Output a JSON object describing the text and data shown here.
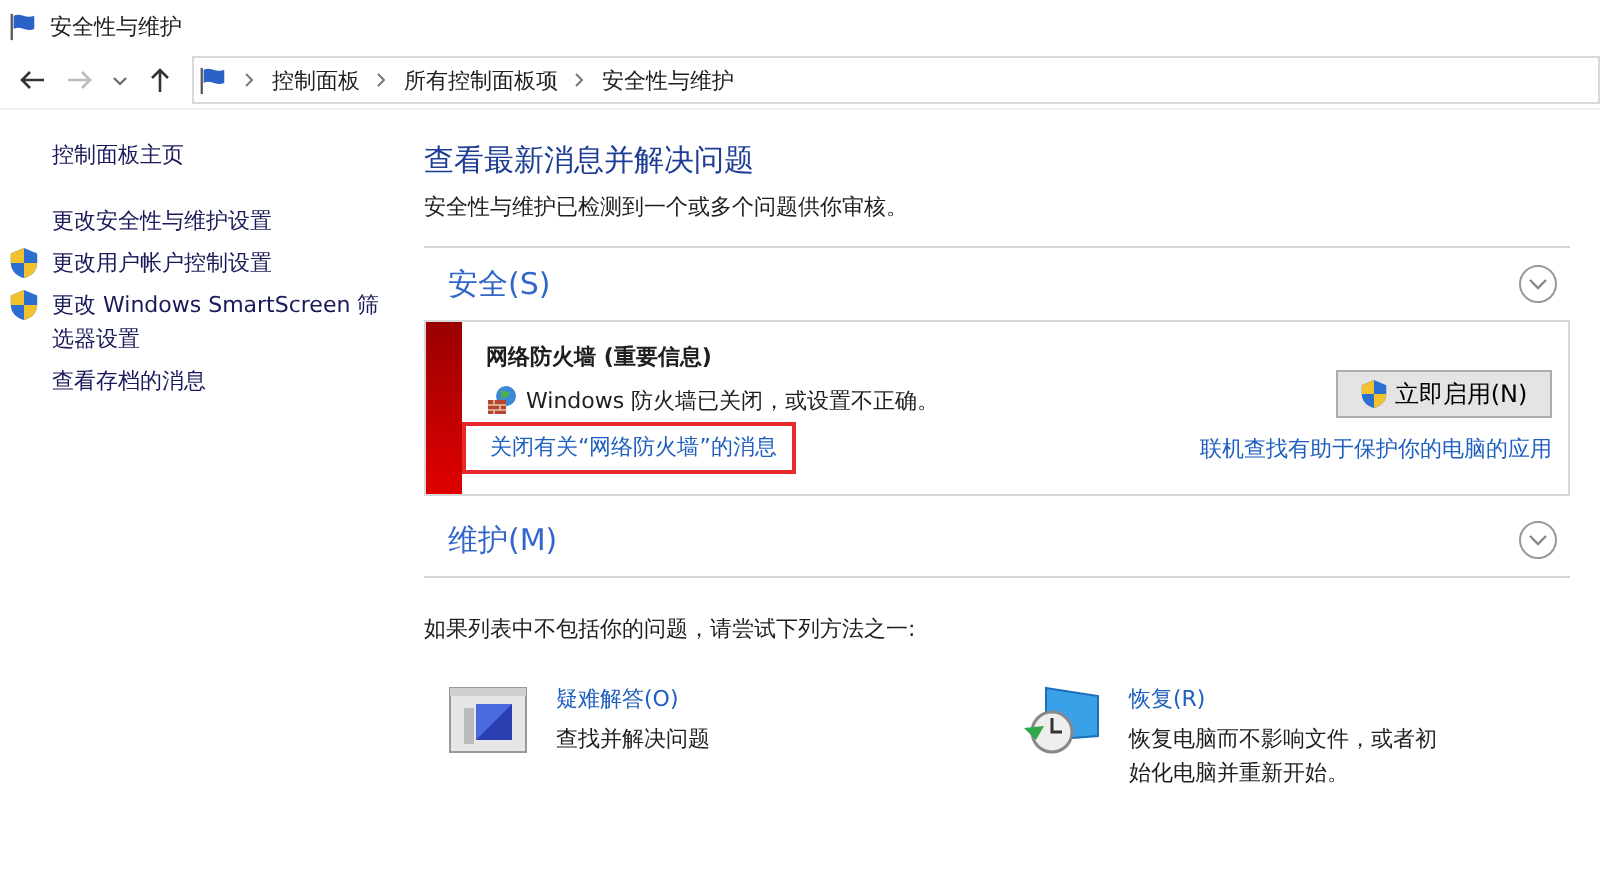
{
  "window": {
    "title": "安全性与维护"
  },
  "breadcrumb": [
    "控制面板",
    "所有控制面板项",
    "安全性与维护"
  ],
  "sidebar": {
    "items": [
      {
        "label": "控制面板主页",
        "shield": false
      },
      {
        "label": "更改安全性与维护设置",
        "shield": false
      },
      {
        "label": "更改用户帐户控制设置",
        "shield": true
      },
      {
        "label": "更改 Windows SmartScreen 筛选器设置",
        "shield": true
      },
      {
        "label": "查看存档的消息",
        "shield": false
      }
    ]
  },
  "heading": "查看最新消息并解决问题",
  "subheading": "安全性与维护已检测到一个或多个问题供你审核。",
  "sections": [
    {
      "title": "安全(S)",
      "messages": [
        {
          "title": "网络防火墙 (重要信息)",
          "text": "Windows 防火墙已关闭，或设置不正确。",
          "button": "立即启用(N)",
          "dismiss_link": "关闭有关“网络防火墙”的消息",
          "highlighted": true,
          "help_link": "联机查找有助于保护你的电脑的应用"
        }
      ]
    },
    {
      "title": "维护(M)"
    }
  ],
  "prompt": "如果列表中不包括你的问题，请尝试下列方法之一:",
  "options": [
    {
      "kind": "troubleshoot",
      "title": "疑难解答(O)",
      "description": "查找并解决问题"
    },
    {
      "kind": "recovery",
      "title": "恢复(R)",
      "description": "恢复电脑而不影响文件，或者初始化电脑并重新开始。"
    }
  ]
}
